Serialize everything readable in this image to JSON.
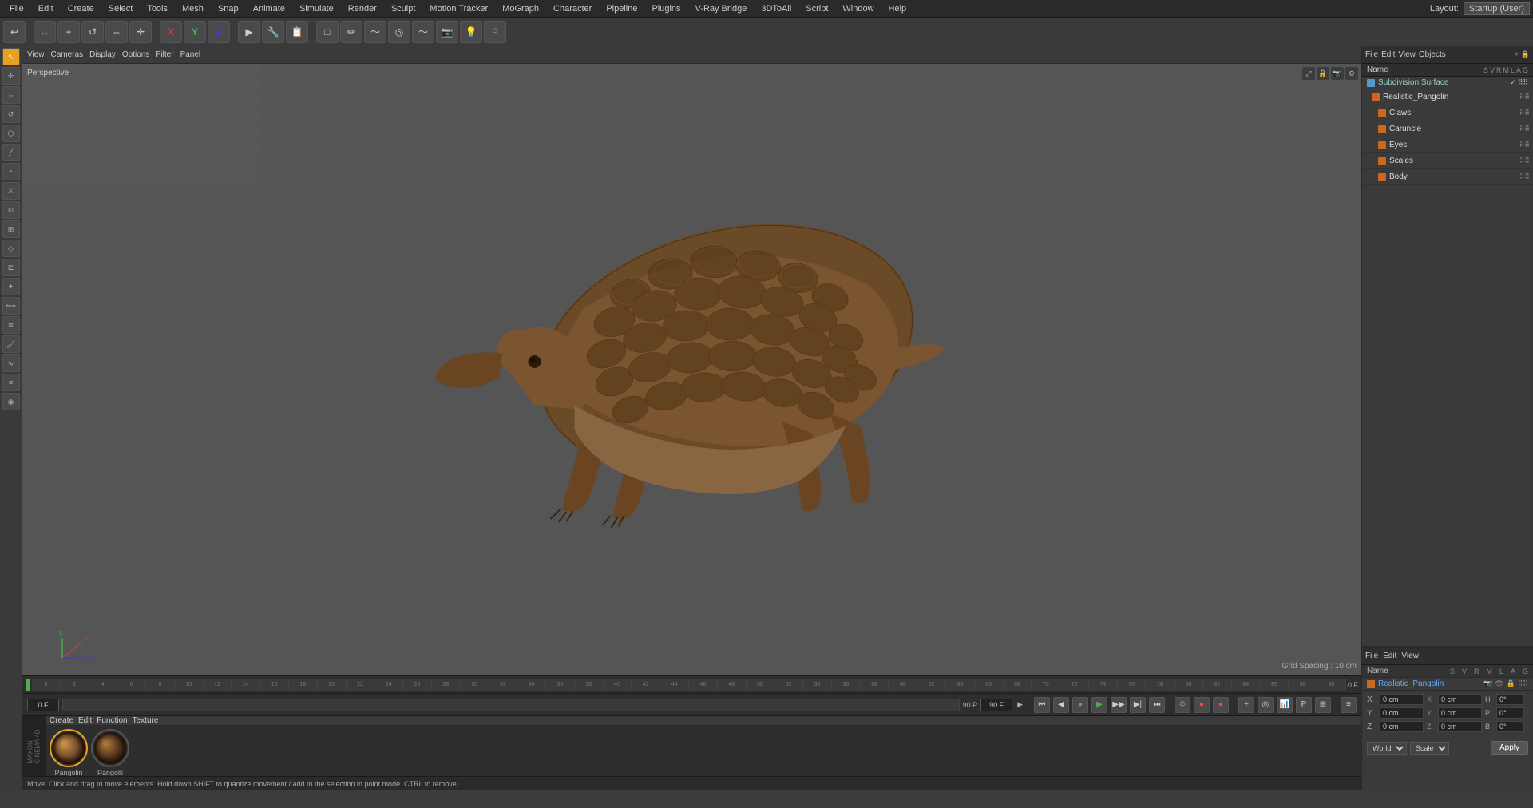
{
  "app": {
    "title": "Cinema 4D",
    "layout": "Layout:",
    "layout_profile": "Startup (User)"
  },
  "menubar": {
    "items": [
      "File",
      "Edit",
      "Create",
      "Select",
      "Tools",
      "Mesh",
      "Snap",
      "Animate",
      "Simulate",
      "Render",
      "Sculpt",
      "Motion Tracker",
      "MoGraph",
      "Character",
      "Pipeline",
      "Plugins",
      "V-Ray Bridge",
      "3DToAll",
      "Script",
      "Window",
      "Help"
    ]
  },
  "viewport": {
    "label": "Perspective",
    "grid_spacing": "Grid Spacing : 10 cm"
  },
  "viewport_toolbar": {
    "items": [
      "View",
      "Cameras",
      "Display",
      "Options",
      "Filter",
      "Panel"
    ]
  },
  "objects_panel": {
    "title": "Objects",
    "objects": [
      {
        "name": "Subdivision Surface",
        "type": "subdiv",
        "indent": 0
      },
      {
        "name": "Realistic_Pangolin",
        "type": "object",
        "indent": 1
      },
      {
        "name": "Claws",
        "type": "object",
        "indent": 2
      },
      {
        "name": "Caruncle",
        "type": "object",
        "indent": 2
      },
      {
        "name": "Eyes",
        "type": "object",
        "indent": 2
      },
      {
        "name": "Scales",
        "type": "object",
        "indent": 2
      },
      {
        "name": "Body",
        "type": "object",
        "indent": 2
      }
    ]
  },
  "right_panel": {
    "toolbar": [
      "File",
      "Edit",
      "View"
    ],
    "attributes": {
      "columns": [
        "Name",
        "S",
        "V",
        "R",
        "M",
        "L",
        "A",
        "G"
      ],
      "selected": "Realistic_Pangolin"
    }
  },
  "timeline": {
    "frames": [
      "0",
      "2",
      "4",
      "6",
      "8",
      "10",
      "12",
      "14",
      "16",
      "18",
      "20",
      "22",
      "24",
      "26",
      "28",
      "30",
      "32",
      "34",
      "36",
      "38",
      "40",
      "42",
      "44",
      "46",
      "48",
      "50",
      "52",
      "54",
      "56",
      "58",
      "60",
      "62",
      "64",
      "66",
      "68",
      "70",
      "72",
      "74",
      "76",
      "78",
      "80",
      "82",
      "84",
      "86",
      "88",
      "90"
    ],
    "end_label": "0 F"
  },
  "playback": {
    "current_frame": "0 F",
    "frame_input": "0 F",
    "end_frame": "90 P",
    "frame2": "90 F"
  },
  "materials": {
    "toolbar": [
      "Create",
      "Edit",
      "Function",
      "Texture"
    ],
    "items": [
      {
        "name": "Pangolin",
        "color1": "#8b6340",
        "color2": "#6b4a2a"
      },
      {
        "name": "Pangolli",
        "color1": "#7a5530",
        "color2": "#5a3a1a"
      }
    ]
  },
  "transform": {
    "x_pos": "0 cm",
    "y_pos": "0 cm",
    "z_pos": "0 cm",
    "x_rot": "0 cm",
    "y_rot": "0 cm",
    "z_rot": "0 cm",
    "x_size": "0 cm",
    "y_size": "0 cm",
    "z_size": "0 cm",
    "h_val": "0°",
    "p_val": "0°",
    "b_val": "0°",
    "coord_system": "World",
    "mode": "Scale",
    "apply_label": "Apply"
  },
  "status": {
    "text": "Move: Click and drag to move elements. Hold down SHIFT to quantize movement / add to the selection in point mode. CTRL to remove."
  }
}
